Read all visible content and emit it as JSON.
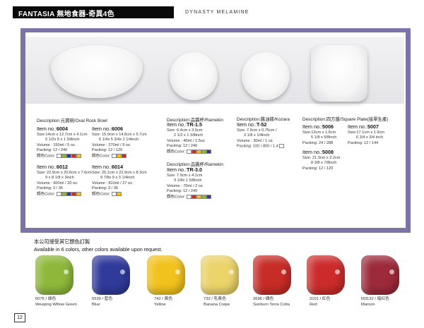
{
  "header": {
    "title": "FANTASIA 無地食器-奇異4色",
    "subtitle": "DYNASTY MELAMINE"
  },
  "colors": {
    "frame": "#7b74a5"
  },
  "products": {
    "oval": {
      "description": "Description:元寶碗/Oval Rock Bowl",
      "items": [
        {
          "no": "6004",
          "lines": [
            "Size:14cm x 12.7cm x 4.1cm",
            "5 1/2x 5 x 1 5/8inch",
            "Volume : 150ml / 5 oz.",
            "Packing: 12 / 240"
          ],
          "color": "顏色Color:"
        },
        {
          "no": "6006",
          "lines": [
            "Size: 15.9cm x 14.6cm x 5.7cm",
            "6 1/4x 5 3/4x 2 1/4inch",
            "Volume : 270ml / 9 oz.",
            "Packing: 12 / 120"
          ],
          "color": "顏色Color:"
        },
        {
          "no": "6012",
          "lines": [
            "Size: 22.9cm x 20.6cm x 7.6cm",
            "9 x 8 1/8 x 3inch",
            "Volume : 600ml / 20 oz.",
            "Packing: 3 / 36"
          ],
          "color": "顏色Color:"
        },
        {
          "no": "6014",
          "lines": [
            "Size: 25.1cm x 22.9cm x 8.3cm",
            "9 7/8x 9 x 3 1/4inch",
            "Volume : 810ml / 27 oz.",
            "Packing: 3 / 36"
          ],
          "color": "顏色Color:"
        }
      ]
    },
    "ramekin": {
      "description": "Description:品醬杯/Ramekin",
      "items": [
        {
          "no": "TR-1.5",
          "lines": [
            "Size: 6.4cm x 3.5cm",
            "2 1/2 x 1 3/8inch",
            "Volume : 40ml / 1.5oz",
            "Packing: 12 / 240"
          ],
          "color": "顏色Color:"
        },
        {
          "no": "TR-3.0",
          "lines": [
            "Size: 7.9cm x 4.1cm",
            "3 1/8x 1 5/8inch",
            "Volume : 70ml / 2 oz.",
            "Packing: 12 / 240"
          ],
          "color": "顏色Color:"
        }
      ]
    },
    "kozara": {
      "description": "Description:醬油碟/Kozara",
      "items": [
        {
          "no": "T-52",
          "lines": [
            "Size: 7.9cm x 0.75cm /",
            "3 1/8 x 1/4inch",
            "Volume : 30ml / 1 oz.",
            "Packing: 100 / 800 / 1.4"
          ]
        }
      ]
    },
    "square": {
      "description": "Description:四方盤/Square Plate(接單生產)",
      "items": [
        {
          "no": "5006",
          "lines": [
            "Size:13cm x 1.6cm",
            "5 1/8 x 5/8inch",
            "Packing: 24 / 288"
          ]
        },
        {
          "no": "5007",
          "lines": [
            "Size:17.1cm x 1.9cm",
            "6 3/4 x 3/4 inch",
            "Packing: 12 / 144"
          ]
        },
        {
          "no": "5008",
          "lines": [
            "Size: 21.3cm x 2.2cm",
            "8 3/8 x 7/8inch",
            "Packing: 12 / 120"
          ]
        }
      ]
    }
  },
  "colors_note": {
    "cn": "本公司接受其它顏色訂製",
    "en": "Available in 6 colors, other colors available upon request."
  },
  "swatches": [
    {
      "code": "6076 / 綠色",
      "name": "Weeping Willow Green",
      "hex": "#8db83a"
    },
    {
      "code": "5539 / 藍色",
      "name": "Blue",
      "hex": "#2f3a9a"
    },
    {
      "code": "742 / 黃色",
      "name": "Yellow",
      "hex": "#f1c21d"
    },
    {
      "code": "732 / 乳黃色",
      "name": "Banana Crepe",
      "hex": "#ecd36a"
    },
    {
      "code": "3696 / 磚色",
      "name": "Sunburn Terra Cotta",
      "hex": "#c72c26"
    },
    {
      "code": "3101 / 紅色",
      "name": "Red",
      "hex": "#cc2b2b"
    },
    {
      "code": "M3132 / 暗紅色",
      "name": "Maroon",
      "hex": "#9c2a3a"
    }
  ],
  "page_number": "12",
  "item_prefix": "Item no.:"
}
